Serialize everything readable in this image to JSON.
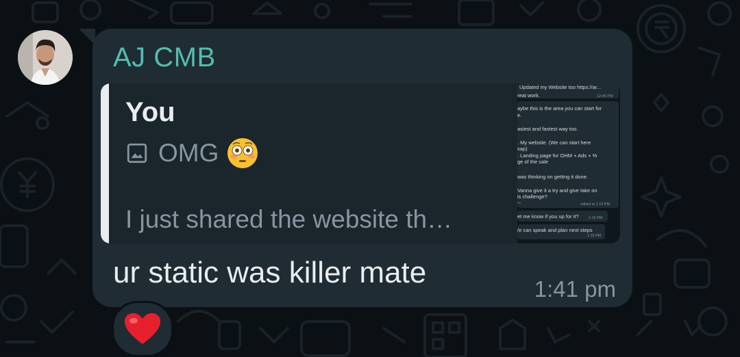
{
  "message": {
    "sender": "AJ CMB",
    "text": "ur static was killer mate",
    "time": "1:41 pm"
  },
  "reply": {
    "author": "You",
    "caption": "OMG",
    "text": "I just shared the website th…"
  },
  "thumbnail": {
    "header": "Updated my Website too  https://ar...",
    "lines": [
      "reat work.",
      "aybe this is the area you can start for",
      "e.",
      "asiest and fastest way too.",
      ". My website. (We can start here",
      "sap)",
      ". Landing page for OHM + Ads + %",
      "ge of the sale",
      "was thinking on getting it done.",
      "Vanna give it a try and give take on",
      "is challenge?",
      "--",
      "et me know if you up for it?",
      "/e can speak and plan next steps"
    ],
    "times": [
      "12:45 PM",
      "edited at 1:19 PM",
      "1:19 PM",
      "1:19 PM"
    ]
  },
  "reaction": {
    "emoji": "heart"
  },
  "colors": {
    "background": "#0b1014",
    "bubble": "#1f2c34",
    "sender_name": "#53bdae",
    "reaction_heart": "#e8202e"
  },
  "icons": [
    "image-icon",
    "flushed-face-emoji",
    "red-heart-emoji",
    "wallpaper-doodles"
  ]
}
